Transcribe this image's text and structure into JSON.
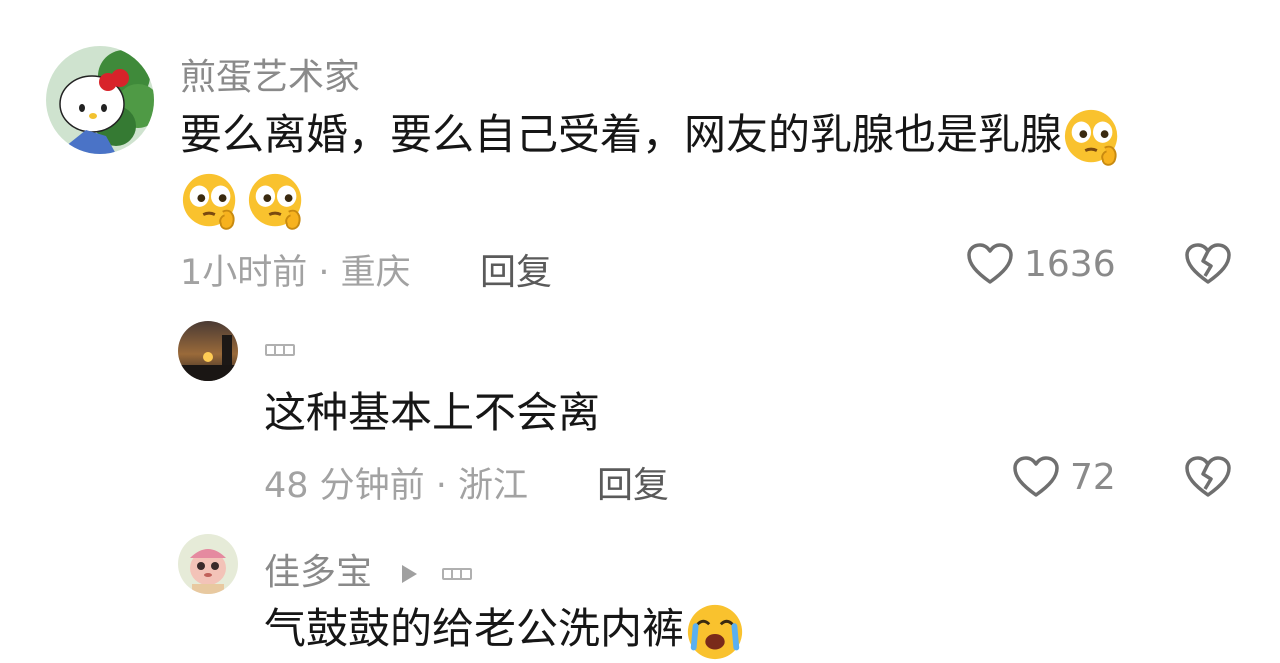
{
  "comments": [
    {
      "username": "煎蛋艺术家",
      "text": "要么离婚，要么自己受着，网友的乳腺也是乳腺",
      "time_location": "1小时前 · 重庆",
      "reply_label": "回复",
      "likes": "1636"
    },
    {
      "username": "",
      "text": "这种基本上不会离",
      "time_location": "48 分钟前 · 浙江",
      "reply_label": "回复",
      "likes": "72"
    },
    {
      "username": "佳多宝",
      "text": "气鼓鼓的给老公洗内裤"
    }
  ],
  "icons": {
    "like": "heart-outline-icon",
    "dislike": "broken-heart-icon",
    "emoji_think": "pondering-face-emoji",
    "emoji_cry": "crying-face-emoji",
    "reply_to": "play-triangle-icon"
  },
  "colors": {
    "username": "#8a8a8a",
    "meta": "#a2a2a2",
    "text": "#161616",
    "icon": "#6f6f6f",
    "emoji_face": "#f9c22e"
  }
}
